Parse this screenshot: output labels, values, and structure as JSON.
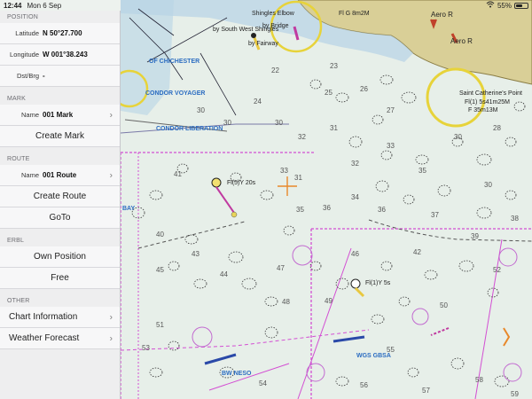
{
  "status": {
    "time": "12:44",
    "date": "Mon 6 Sep",
    "battery": "55%",
    "battery_level": 0.55
  },
  "sidebar": {
    "position": {
      "header": "POSITION",
      "latitude_label": "Latitude",
      "latitude": "N 50°27.700",
      "longitude_label": "Longitude",
      "longitude": "W 001°38.243",
      "dstbrg_label": "Dst/Brg",
      "dstbrg": "-"
    },
    "mark": {
      "header": "MARK",
      "name_label": "Name",
      "name": "001 Mark",
      "create": "Create Mark"
    },
    "route": {
      "header": "ROUTE",
      "name_label": "Name",
      "name": "001 Route",
      "create": "Create Route",
      "goto": "GoTo"
    },
    "erbl": {
      "header": "ERBL",
      "own": "Own Position",
      "free": "Free"
    },
    "other": {
      "header": "OTHER",
      "chart_info": "Chart Information",
      "weather": "Weather Forecast"
    }
  },
  "map": {
    "labels": {
      "aero1": "Aero R",
      "aero2": "Aero R",
      "fl_top": "Fl G 8m2M",
      "st_catherine": "Saint Catherine's Point",
      "fl_st": "Fl(1) 5s41m25M",
      "f35": "F 35m13M",
      "condor_voyager": "CONDOR VOYAGER",
      "condor_liberation": "CONDOR LIBERATION",
      "chichester": "OF CHICHESTER",
      "fl5y": "Fl(5)Y 20s",
      "fl1y": "Fl(1)Y 5s",
      "wgs": "WGS GBSA",
      "bwneso": "BW NESO",
      "shingles": "Shingles Elbow",
      "bridge": "by Bridge",
      "fairway": "by Fairway",
      "south_west": "by South West Shingles",
      "bay": "BAY"
    },
    "depths": [
      "33",
      "31",
      "30",
      "32",
      "31",
      "25",
      "35",
      "36",
      "34",
      "36",
      "30",
      "30",
      "30",
      "40",
      "45",
      "44",
      "47",
      "51",
      "48",
      "49",
      "53",
      "55",
      "50",
      "52",
      "56",
      "57",
      "54",
      "59",
      "58",
      "46",
      "43",
      "42",
      "39",
      "38",
      "37",
      "41",
      "35",
      "33",
      "32",
      "30",
      "28",
      "27",
      "26",
      "23",
      "24",
      "22"
    ]
  }
}
